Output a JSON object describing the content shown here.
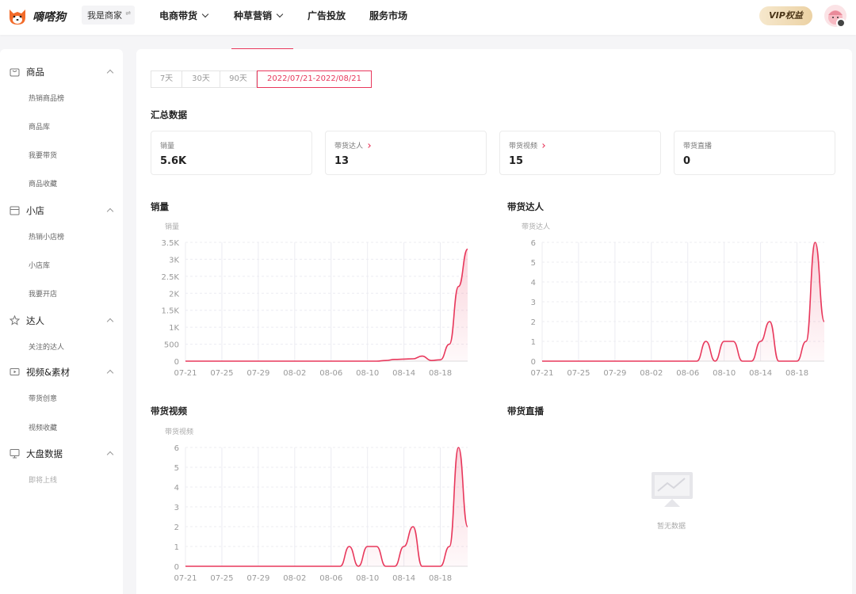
{
  "header": {
    "brand": "嘀嗒狗",
    "merchant_label": "我是商家",
    "nav": [
      {
        "label": "电商带货",
        "has_menu": true
      },
      {
        "label": "种草营销",
        "has_menu": true
      },
      {
        "label": "广告投放",
        "has_menu": false
      },
      {
        "label": "服务市场",
        "has_menu": false
      }
    ],
    "vip_label": "VIP权益"
  },
  "sidebar": {
    "groups": [
      {
        "label": "商品",
        "icon": "bag-icon",
        "items": [
          "热销商品榜",
          "商品库",
          "我要带货",
          "商品收藏"
        ]
      },
      {
        "label": "小店",
        "icon": "store-icon",
        "items": [
          "热销小店榜",
          "小店库",
          "我要开店"
        ]
      },
      {
        "label": "达人",
        "icon": "star-icon",
        "items": [
          "关注的达人"
        ]
      },
      {
        "label": "视频&素材",
        "icon": "video-icon",
        "items": [
          "带货创意",
          "视频收藏"
        ]
      },
      {
        "label": "大盘数据",
        "icon": "monitor-icon",
        "items": [
          "即将上线"
        ]
      }
    ]
  },
  "filters": {
    "ranges": [
      "7天",
      "30天",
      "90天",
      "2022/07/21-2022/08/21"
    ],
    "active_index": 3
  },
  "summary": {
    "title": "汇总数据",
    "cards": [
      {
        "label": "销量",
        "value": "5.6K",
        "has_link": false
      },
      {
        "label": "带货达人",
        "value": "13",
        "has_link": true
      },
      {
        "label": "带货视频",
        "value": "15",
        "has_link": true
      },
      {
        "label": "带货直播",
        "value": "0",
        "has_link": false
      }
    ]
  },
  "charts": {
    "sales_title": "销量",
    "influencers_title": "带货达人",
    "videos_title": "带货视频",
    "live_title": "带货直播",
    "live_empty_text": "暂无数据"
  },
  "colors": {
    "accent": "#e8385c",
    "grid": "#ececf2"
  },
  "chart_data": [
    {
      "type": "line",
      "title": "销量",
      "ylabel": "销量",
      "ylim": [
        0,
        3500
      ],
      "yticks": [
        0,
        500,
        1000,
        1500,
        2000,
        2500,
        3000,
        3500
      ],
      "ytick_labels": [
        "0",
        "500",
        "1K",
        "1.5K",
        "2K",
        "2.5K",
        "3K",
        "3.5K"
      ],
      "xticks": [
        "07-21",
        "07-25",
        "07-29",
        "08-02",
        "08-06",
        "08-10",
        "08-14",
        "08-18"
      ],
      "x": [
        "07-21",
        "07-22",
        "07-23",
        "07-24",
        "07-25",
        "07-26",
        "07-27",
        "07-28",
        "07-29",
        "07-30",
        "07-31",
        "08-01",
        "08-02",
        "08-03",
        "08-04",
        "08-05",
        "08-06",
        "08-07",
        "08-08",
        "08-09",
        "08-10",
        "08-11",
        "08-12",
        "08-13",
        "08-14",
        "08-15",
        "08-16",
        "08-17",
        "08-18",
        "08-19",
        "08-20",
        "08-21"
      ],
      "series": [
        {
          "values": [
            0,
            0,
            0,
            0,
            0,
            0,
            0,
            0,
            0,
            0,
            0,
            0,
            0,
            0,
            0,
            0,
            0,
            0,
            0,
            0,
            0,
            0,
            20,
            50,
            60,
            70,
            150,
            20,
            40,
            500,
            2200,
            3300
          ]
        }
      ]
    },
    {
      "type": "line",
      "title": "带货达人",
      "ylabel": "带货达人",
      "ylim": [
        0,
        6
      ],
      "yticks": [
        0,
        1,
        2,
        3,
        4,
        5,
        6
      ],
      "xticks": [
        "07-21",
        "07-25",
        "07-29",
        "08-02",
        "08-06",
        "08-10",
        "08-14",
        "08-18"
      ],
      "x": [
        "07-21",
        "07-22",
        "07-23",
        "07-24",
        "07-25",
        "07-26",
        "07-27",
        "07-28",
        "07-29",
        "07-30",
        "07-31",
        "08-01",
        "08-02",
        "08-03",
        "08-04",
        "08-05",
        "08-06",
        "08-07",
        "08-08",
        "08-09",
        "08-10",
        "08-11",
        "08-12",
        "08-13",
        "08-14",
        "08-15",
        "08-16",
        "08-17",
        "08-18",
        "08-19",
        "08-20",
        "08-21"
      ],
      "series": [
        {
          "values": [
            0,
            0,
            0,
            0,
            0,
            0,
            0,
            0,
            0,
            0,
            0,
            0,
            0,
            0,
            0,
            0,
            0,
            0,
            1,
            0,
            1,
            1,
            0,
            0,
            1,
            2,
            0,
            0,
            0,
            1,
            6,
            2
          ]
        }
      ]
    },
    {
      "type": "line",
      "title": "带货视频",
      "ylabel": "带货视频",
      "ylim": [
        0,
        6
      ],
      "yticks": [
        0,
        1,
        2,
        3,
        4,
        5,
        6
      ],
      "xticks": [
        "07-21",
        "07-25",
        "07-29",
        "08-02",
        "08-06",
        "08-10",
        "08-14",
        "08-18"
      ],
      "x": [
        "07-21",
        "07-22",
        "07-23",
        "07-24",
        "07-25",
        "07-26",
        "07-27",
        "07-28",
        "07-29",
        "07-30",
        "07-31",
        "08-01",
        "08-02",
        "08-03",
        "08-04",
        "08-05",
        "08-06",
        "08-07",
        "08-08",
        "08-09",
        "08-10",
        "08-11",
        "08-12",
        "08-13",
        "08-14",
        "08-15",
        "08-16",
        "08-17",
        "08-18",
        "08-19",
        "08-20",
        "08-21"
      ],
      "series": [
        {
          "values": [
            0,
            0,
            0,
            0,
            0,
            0,
            0,
            0,
            0,
            0,
            0,
            0,
            0,
            0,
            0,
            0,
            0,
            0,
            1,
            0,
            1,
            1,
            0,
            0,
            1,
            2,
            0,
            0,
            0,
            1,
            6,
            2
          ]
        }
      ]
    },
    {
      "type": "line",
      "title": "带货直播",
      "empty": true
    }
  ]
}
